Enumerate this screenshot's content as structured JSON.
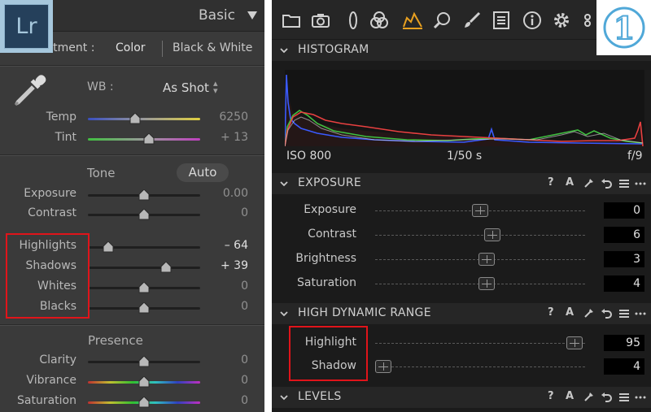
{
  "lightroom": {
    "logo_text": "Lr",
    "panel_title": "Basic",
    "treatment": {
      "label": "Treatment :",
      "color": "Color",
      "bw": "Black & White"
    },
    "wb": {
      "label": "WB :",
      "value": "As Shot"
    },
    "temp": {
      "label": "Temp",
      "value": "6250"
    },
    "tint": {
      "label": "Tint",
      "value": "+ 13"
    },
    "tone": {
      "title": "Tone",
      "auto_label": "Auto",
      "sliders": [
        {
          "label": "Exposure",
          "value": "0.00",
          "level": 0.5
        },
        {
          "label": "Contrast",
          "value": "0",
          "level": 0.5
        },
        {
          "label": "Highlights",
          "value": "– 64",
          "level": 0.18
        },
        {
          "label": "Shadows",
          "value": "+ 39",
          "level": 0.695
        },
        {
          "label": "Whites",
          "value": "0",
          "level": 0.5
        },
        {
          "label": "Blacks",
          "value": "0",
          "level": 0.5
        }
      ]
    },
    "presence": {
      "title": "Presence",
      "sliders": [
        {
          "label": "Clarity",
          "value": "0",
          "level": 0.5
        },
        {
          "label": "Vibrance",
          "value": "0",
          "level": 0.5
        },
        {
          "label": "Saturation",
          "value": "0",
          "level": 0.5
        }
      ]
    },
    "colors": {
      "highlight_box": "#e0141a",
      "text": "#b8b8b8"
    }
  },
  "captureone": {
    "badge_text": "1",
    "toolbar_icons": [
      "folder-icon",
      "camera-icon",
      "lens-icon",
      "color-icon",
      "exposure-icon",
      "details-icon",
      "brush-icon",
      "metadata-icon",
      "info-icon",
      "gear-icon",
      "more-icon"
    ],
    "histogram": {
      "title": "HISTOGRAM",
      "iso": "ISO 800",
      "shutter": "1/50 s",
      "aperture": "f/9"
    },
    "exposure": {
      "title": "EXPOSURE",
      "sliders": [
        {
          "label": "Exposure",
          "value": "0",
          "level": 0.5
        },
        {
          "label": "Contrast",
          "value": "6",
          "level": 0.56
        },
        {
          "label": "Brightness",
          "value": "3",
          "level": 0.53
        },
        {
          "label": "Saturation",
          "value": "4",
          "level": 0.53
        }
      ]
    },
    "hdr": {
      "title": "HIGH DYNAMIC RANGE",
      "sliders": [
        {
          "label": "Highlight",
          "value": "95",
          "level": 0.95
        },
        {
          "label": "Shadow",
          "value": "4",
          "level": 0.04
        }
      ]
    },
    "levels": {
      "title": "LEVELS"
    },
    "panel_tools": {
      "help": "?",
      "auto": "A"
    },
    "colors": {
      "accent": "#e8a020",
      "highlight_box": "#e0141a"
    }
  }
}
